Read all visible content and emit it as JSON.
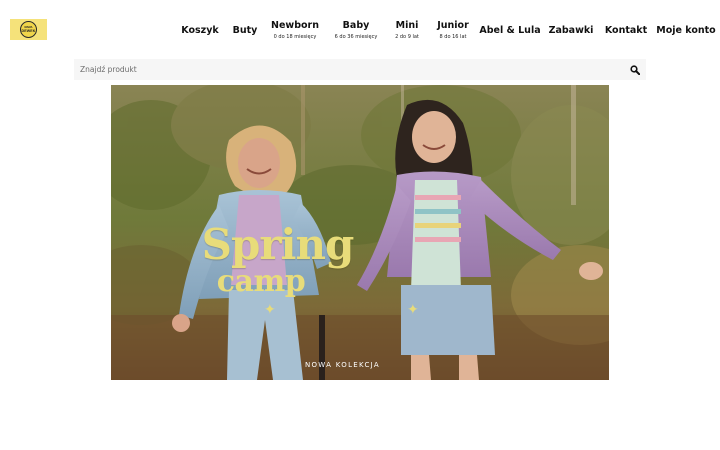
{
  "brand": {
    "logo_top": "MAMA",
    "logo_text": "DEWEK",
    "color": "#f5e27a"
  },
  "nav": {
    "items": [
      {
        "label": "Koszyk",
        "sub": ""
      },
      {
        "label": "Buty",
        "sub": ""
      },
      {
        "label": "Newborn",
        "sub": "0 do 18 miesięcy"
      },
      {
        "label": "Baby",
        "sub": "6 do 36 miesięcy"
      },
      {
        "label": "Mini",
        "sub": "2 do 9 lat"
      },
      {
        "label": "Junior",
        "sub": "8 do 16 lat"
      },
      {
        "label": "Abel & Lula",
        "sub": ""
      },
      {
        "label": "Zabawki",
        "sub": ""
      },
      {
        "label": "Kontakt",
        "sub": ""
      },
      {
        "label": "Moje konto",
        "sub": ""
      }
    ]
  },
  "search": {
    "placeholder": "Znajdź produkt",
    "value": "",
    "icon": "search-icon"
  },
  "hero": {
    "title": "Spring",
    "subtitle": "camp",
    "cta": "NOWA KOLEKCJA",
    "accent_color": "#e8dc7a"
  }
}
